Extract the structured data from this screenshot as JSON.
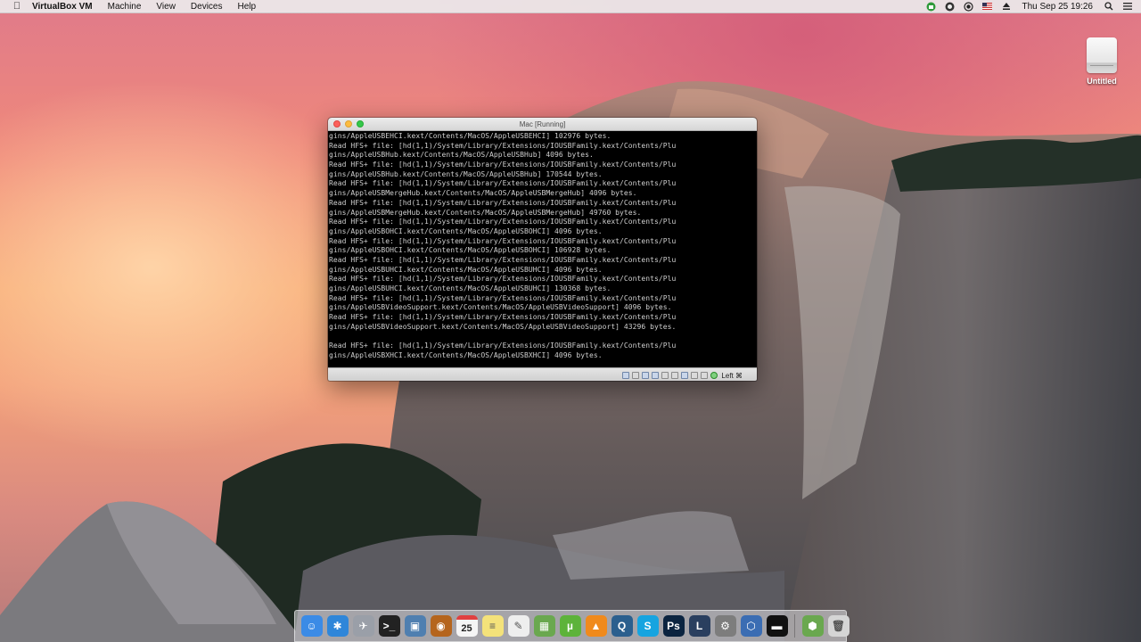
{
  "menubar": {
    "app_name": "VirtualBox VM",
    "items": [
      "Machine",
      "View",
      "Devices",
      "Help"
    ],
    "clock": "Thu Sep 25  19:26"
  },
  "desktop": {
    "disk_label": "Untitled"
  },
  "vm_window": {
    "title": "Mac [Running]",
    "console_lines": [
      "gins/AppleUSBEHCI.kext/Contents/MacOS/AppleUSBEHCI] 102976 bytes.",
      "Read HFS+ file: [hd(1,1)/System/Library/Extensions/IOUSBFamily.kext/Contents/Plu",
      "gins/AppleUSBHub.kext/Contents/MacOS/AppleUSBHub] 4096 bytes.",
      "Read HFS+ file: [hd(1,1)/System/Library/Extensions/IOUSBFamily.kext/Contents/Plu",
      "gins/AppleUSBHub.kext/Contents/MacOS/AppleUSBHub] 170544 bytes.",
      "Read HFS+ file: [hd(1,1)/System/Library/Extensions/IOUSBFamily.kext/Contents/Plu",
      "gins/AppleUSBMergeHub.kext/Contents/MacOS/AppleUSBMergeHub] 4096 bytes.",
      "Read HFS+ file: [hd(1,1)/System/Library/Extensions/IOUSBFamily.kext/Contents/Plu",
      "gins/AppleUSBMergeHub.kext/Contents/MacOS/AppleUSBMergeHub] 49760 bytes.",
      "Read HFS+ file: [hd(1,1)/System/Library/Extensions/IOUSBFamily.kext/Contents/Plu",
      "gins/AppleUSBOHCI.kext/Contents/MacOS/AppleUSBOHCI] 4096 bytes.",
      "Read HFS+ file: [hd(1,1)/System/Library/Extensions/IOUSBFamily.kext/Contents/Plu",
      "gins/AppleUSBOHCI.kext/Contents/MacOS/AppleUSBOHCI] 106928 bytes.",
      "Read HFS+ file: [hd(1,1)/System/Library/Extensions/IOUSBFamily.kext/Contents/Plu",
      "gins/AppleUSBUHCI.kext/Contents/MacOS/AppleUSBUHCI] 4096 bytes.",
      "Read HFS+ file: [hd(1,1)/System/Library/Extensions/IOUSBFamily.kext/Contents/Plu",
      "gins/AppleUSBUHCI.kext/Contents/MacOS/AppleUSBUHCI] 130368 bytes.",
      "Read HFS+ file: [hd(1,1)/System/Library/Extensions/IOUSBFamily.kext/Contents/Plu",
      "gins/AppleUSBVideoSupport.kext/Contents/MacOS/AppleUSBVideoSupport] 4096 bytes.",
      "Read HFS+ file: [hd(1,1)/System/Library/Extensions/IOUSBFamily.kext/Contents/Plu",
      "gins/AppleUSBVideoSupport.kext/Contents/MacOS/AppleUSBVideoSupport] 43296 bytes.",
      "",
      "Read HFS+ file: [hd(1,1)/System/Library/Extensions/IOUSBFamily.kext/Contents/Plu",
      "gins/AppleUSBXHCI.kext/Contents/MacOS/AppleUSBXHCI] 4096 bytes."
    ],
    "host_key": "Left ⌘"
  },
  "dock": {
    "calendar_day": "25",
    "apps": [
      {
        "name": "finder",
        "color": "#3b8be6",
        "glyph": "☺"
      },
      {
        "name": "safari",
        "color": "#2f86d9",
        "glyph": "✱"
      },
      {
        "name": "launchpad",
        "color": "#9a9fa8",
        "glyph": "✈"
      },
      {
        "name": "terminal",
        "color": "#222222",
        "glyph": ">_"
      },
      {
        "name": "preview",
        "color": "#4f7fb0",
        "glyph": "▣"
      },
      {
        "name": "disk-utility",
        "color": "#b5651d",
        "glyph": "◉"
      },
      {
        "name": "calendar",
        "color": "#f5f5f5",
        "glyph": ""
      },
      {
        "name": "notes",
        "color": "#f4e27a",
        "glyph": "≡"
      },
      {
        "name": "textedit",
        "color": "#eeeeee",
        "glyph": "✎"
      },
      {
        "name": "app-store-folder",
        "color": "#6aa84f",
        "glyph": "▦"
      },
      {
        "name": "utorrent",
        "color": "#5db33a",
        "glyph": "µ"
      },
      {
        "name": "vlc",
        "color": "#f08a1c",
        "glyph": "▲"
      },
      {
        "name": "quicktime",
        "color": "#2b5f8e",
        "glyph": "Q"
      },
      {
        "name": "skype",
        "color": "#16a4e0",
        "glyph": "S"
      },
      {
        "name": "photoshop",
        "color": "#0b2440",
        "glyph": "Ps"
      },
      {
        "name": "lightroom",
        "color": "#2a3f5f",
        "glyph": "L"
      },
      {
        "name": "system-preferences",
        "color": "#7d7d7d",
        "glyph": "⚙"
      },
      {
        "name": "virtualbox",
        "color": "#3b6db3",
        "glyph": "⬡"
      },
      {
        "name": "vm-window",
        "color": "#111111",
        "glyph": "▬"
      },
      {
        "name": "downloads-stack",
        "color": "#6aa84f",
        "glyph": "⬢"
      },
      {
        "name": "trash",
        "color": "#d5d5d5",
        "glyph": "🗑"
      }
    ]
  }
}
